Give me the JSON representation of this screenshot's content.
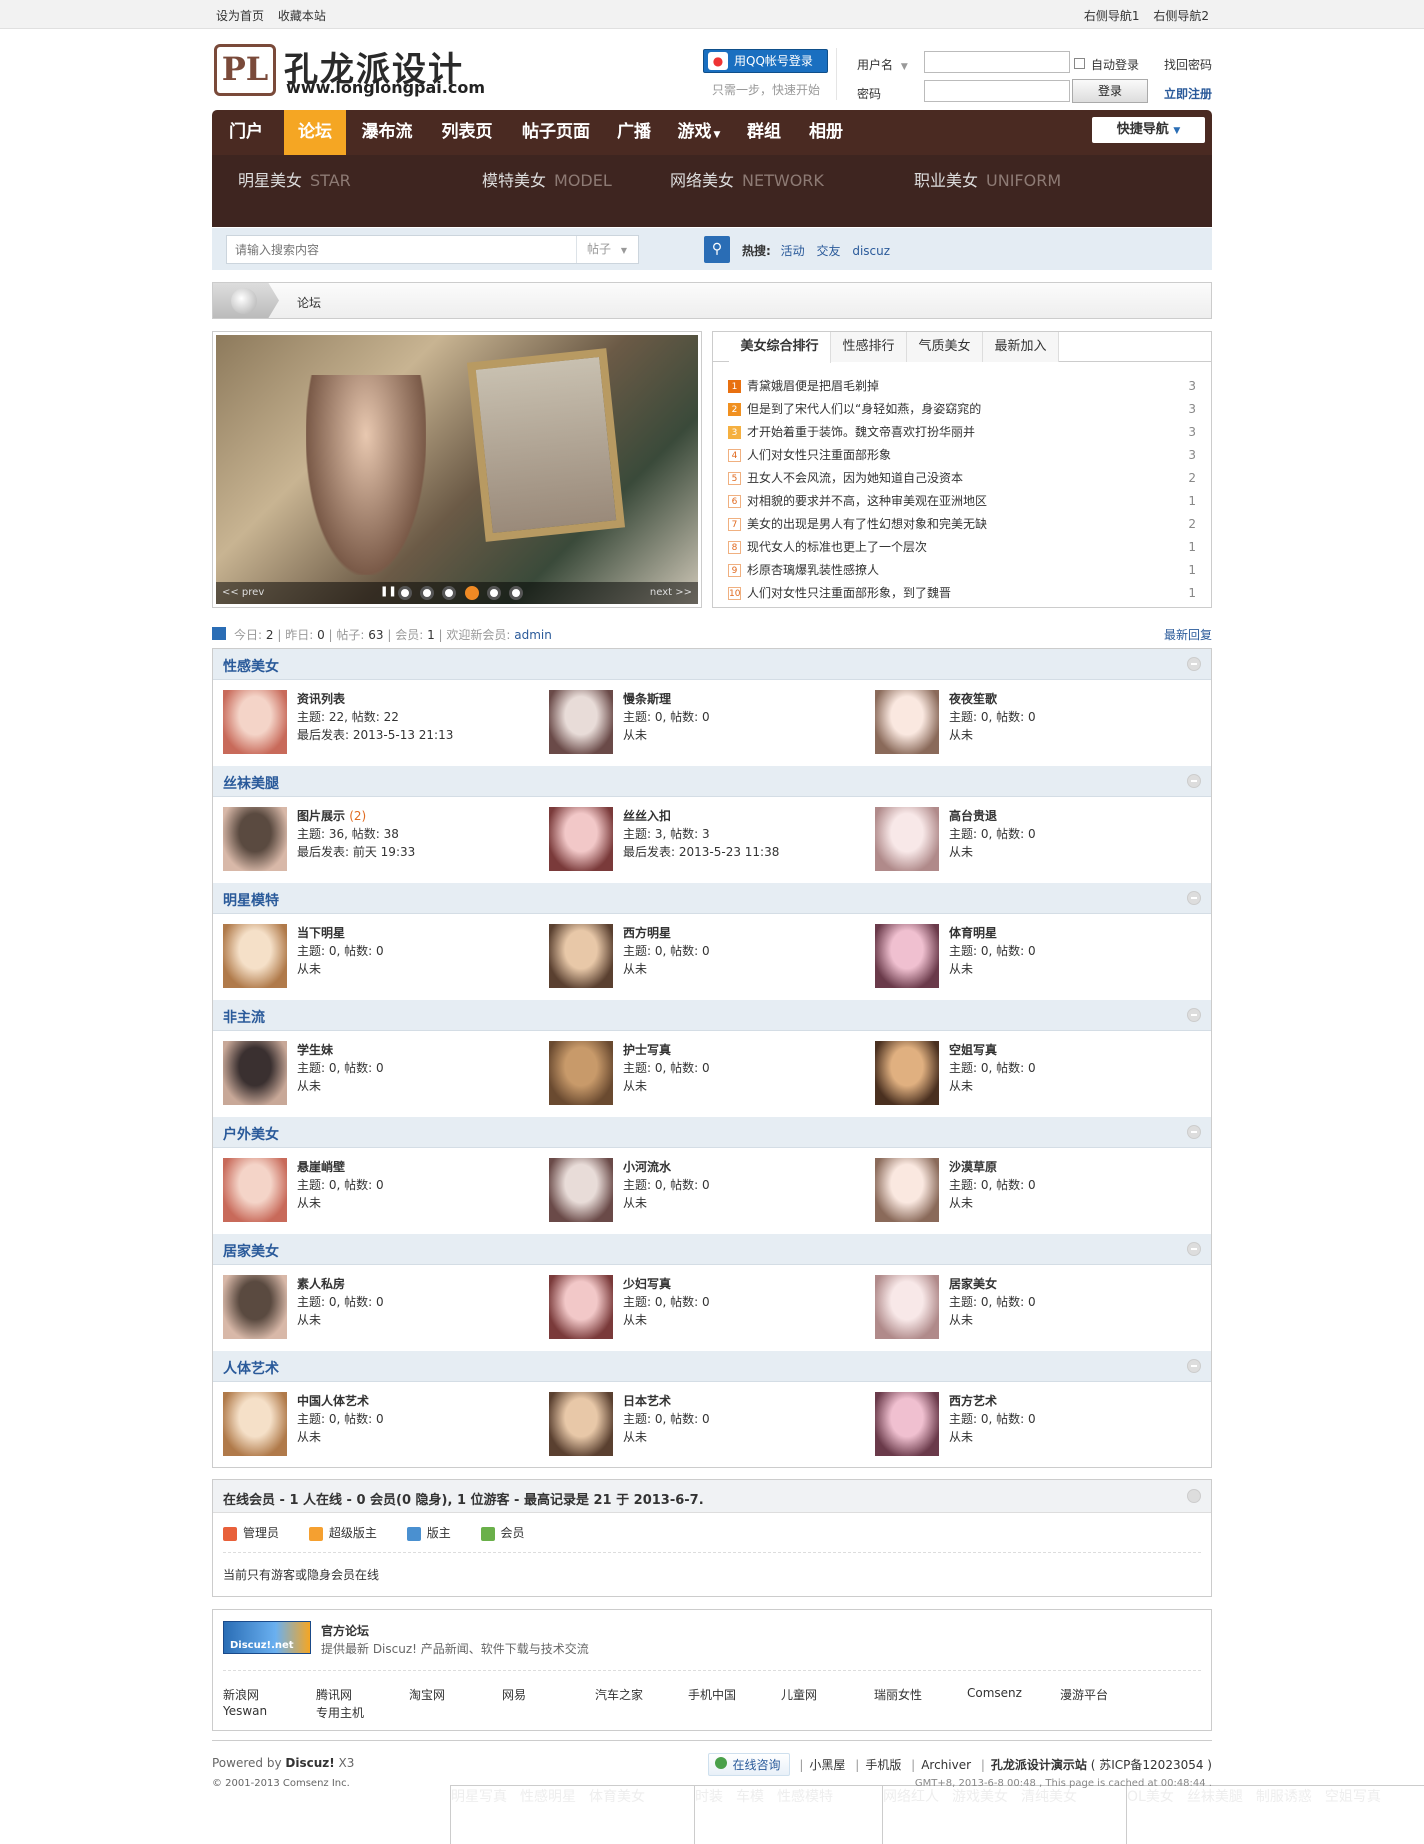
{
  "topbar": {
    "left": [
      "设为首页",
      "收藏本站"
    ],
    "right": [
      "右侧导航1",
      "右侧导航2"
    ]
  },
  "header": {
    "logo_mark": "PL",
    "logo_cn": "孔龙派设计",
    "logo_en": "www.longlongpai.com",
    "qq_login": "用QQ帐号登录",
    "qq_sub": "只需一步，快速开始",
    "username_label": "用户名",
    "password_label": "密码",
    "auto_login": "自动登录",
    "login_button": "登录",
    "forgot_password": "找回密码",
    "register": "立即注册"
  },
  "nav": {
    "items": [
      "门户",
      "论坛",
      "瀑布流",
      "列表页",
      "帖子页面",
      "广播",
      "游戏",
      "群组",
      "相册"
    ],
    "active": "论坛",
    "quick_nav": "快捷导航"
  },
  "subnav": [
    {
      "title": "明星美女",
      "en": "STAR",
      "links": [
        "明星写真",
        "性感明星",
        "体育美女"
      ]
    },
    {
      "title": "模特美女",
      "en": "MODEL",
      "links": [
        "时装",
        "车模",
        "性感模特"
      ]
    },
    {
      "title": "网络美女",
      "en": "NETWORK",
      "links": [
        "网络红人",
        "游戏美女",
        "清纯美女"
      ]
    },
    {
      "title": "职业美女",
      "en": "UNIFORM",
      "links": [
        "OL美女",
        "丝袜美腿",
        "制服诱惑",
        "空姐写真"
      ]
    }
  ],
  "search": {
    "placeholder": "请输入搜索内容",
    "type": "帖子",
    "hot_label": "热搜:",
    "hot": [
      "活动",
      "交友",
      "discuz"
    ]
  },
  "breadcrumb": "论坛",
  "slider": {
    "prev": "<< prev",
    "next": "next >>",
    "active_dot": 4,
    "dot_count": 6
  },
  "ranking": {
    "tabs": [
      "美女综合排行",
      "性感排行",
      "气质美女",
      "最新加入"
    ],
    "items": [
      {
        "n": "1",
        "title": "青黛娥眉便是把眉毛剃掉",
        "count": "3"
      },
      {
        "n": "2",
        "title": "但是到了宋代人们以“身轻如燕，身姿窈窕的",
        "count": "3"
      },
      {
        "n": "3",
        "title": "才开始着重于装饰。魏文帝喜欢打扮华丽并",
        "count": "3"
      },
      {
        "n": "4",
        "title": "人们对女性只注重面部形象",
        "count": "3"
      },
      {
        "n": "5",
        "title": "丑女人不会风流，因为她知道自己没资本",
        "count": "2"
      },
      {
        "n": "6",
        "title": "对相貌的要求并不高，这种审美观在亚洲地区",
        "count": "1"
      },
      {
        "n": "7",
        "title": "美女的出现是男人有了性幻想对象和完美无缺",
        "count": "2"
      },
      {
        "n": "8",
        "title": "现代女人的标准也更上了一个层次",
        "count": "1"
      },
      {
        "n": "9",
        "title": "杉原杏璃爆乳装性感撩人",
        "count": "1"
      },
      {
        "n": "10",
        "title": "人们对女性只注重面部形象，到了魏晋",
        "count": "1"
      }
    ]
  },
  "stats": {
    "today_label": "今日:",
    "today": "2",
    "yesterday_label": "昨日:",
    "yesterday": "0",
    "posts_label": "帖子:",
    "posts": "63",
    "members_label": "会员:",
    "members": "1",
    "welcome_label": "欢迎新会员:",
    "newest": "admin",
    "latest_reply": "最新回复"
  },
  "categories": [
    {
      "title": "性感美女",
      "forums": [
        {
          "name": "资讯列表",
          "new": "",
          "l2": "主题: 22, 帖数: 22",
          "l3": "最后发表: 2013-5-13 21:13"
        },
        {
          "name": "慢条斯理",
          "new": "",
          "l2": "主题: 0, 帖数: 0",
          "l3": "从未"
        },
        {
          "name": "夜夜笙歌",
          "new": "",
          "l2": "主题: 0, 帖数: 0",
          "l3": "从未"
        }
      ]
    },
    {
      "title": "丝袜美腿",
      "forums": [
        {
          "name": "图片展示",
          "new": "(2)",
          "l2": "主题: 36, 帖数: 38",
          "l3": "最后发表: 前天 19:33"
        },
        {
          "name": "丝丝入扣",
          "new": "",
          "l2": "主题: 3, 帖数: 3",
          "l3": "最后发表: 2013-5-23 11:38"
        },
        {
          "name": "高台贵退",
          "new": "",
          "l2": "主题: 0, 帖数: 0",
          "l3": "从未"
        }
      ]
    },
    {
      "title": "明星模特",
      "forums": [
        {
          "name": "当下明星",
          "new": "",
          "l2": "主题: 0, 帖数: 0",
          "l3": "从未"
        },
        {
          "name": "西方明星",
          "new": "",
          "l2": "主题: 0, 帖数: 0",
          "l3": "从未"
        },
        {
          "name": "体育明星",
          "new": "",
          "l2": "主题: 0, 帖数: 0",
          "l3": "从未"
        }
      ]
    },
    {
      "title": "非主流",
      "forums": [
        {
          "name": "学生妹",
          "new": "",
          "l2": "主题: 0, 帖数: 0",
          "l3": "从未"
        },
        {
          "name": "护士写真",
          "new": "",
          "l2": "主题: 0, 帖数: 0",
          "l3": "从未"
        },
        {
          "name": "空姐写真",
          "new": "",
          "l2": "主题: 0, 帖数: 0",
          "l3": "从未"
        }
      ]
    },
    {
      "title": "户外美女",
      "forums": [
        {
          "name": "悬崖峭壁",
          "new": "",
          "l2": "主题: 0, 帖数: 0",
          "l3": "从未"
        },
        {
          "name": "小河流水",
          "new": "",
          "l2": "主题: 0, 帖数: 0",
          "l3": "从未"
        },
        {
          "name": "沙漠草原",
          "new": "",
          "l2": "主题: 0, 帖数: 0",
          "l3": "从未"
        }
      ]
    },
    {
      "title": "居家美女",
      "forums": [
        {
          "name": "素人私房",
          "new": "",
          "l2": "主题: 0, 帖数: 0",
          "l3": "从未"
        },
        {
          "name": "少妇写真",
          "new": "",
          "l2": "主题: 0, 帖数: 0",
          "l3": "从未"
        },
        {
          "name": "居家美女",
          "new": "",
          "l2": "主题: 0, 帖数: 0",
          "l3": "从未"
        }
      ]
    },
    {
      "title": "人体艺术",
      "forums": [
        {
          "name": "中国人体艺术",
          "new": "",
          "l2": "主题: 0, 帖数: 0",
          "l3": "从未"
        },
        {
          "name": "日本艺术",
          "new": "",
          "l2": "主题: 0, 帖数: 0",
          "l3": "从未"
        },
        {
          "name": "西方艺术",
          "new": "",
          "l2": "主题: 0, 帖数: 0",
          "l3": "从未"
        }
      ]
    }
  ],
  "online": {
    "title": "在线会员 - 1 人在线 - 0 会员(0 隐身), 1 位游客 - 最高记录是 21 于 2013-6-7.",
    "legend": [
      {
        "label": "管理员",
        "color": "#e8603a"
      },
      {
        "label": "超级版主",
        "color": "#f5a030"
      },
      {
        "label": "版主",
        "color": "#4a90d0"
      },
      {
        "label": "会员",
        "color": "#6ab04a"
      }
    ],
    "note": "当前只有游客或隐身会员在线"
  },
  "links": {
    "banner": "Discuz!.net",
    "official_title": "官方论坛",
    "official_desc": "提供最新 Discuz! 产品新闻、软件下载与技术交流",
    "row1": [
      "新浪网",
      "腾讯网",
      "淘宝网",
      "网易",
      "汽车之家",
      "手机中国",
      "儿童网",
      "瑞丽女性",
      "Comsenz",
      "漫游平台"
    ],
    "row2": [
      "Yeswan",
      "专用主机"
    ]
  },
  "footer": {
    "powered_prefix": "Powered by ",
    "powered_brand": "Discuz!",
    "powered_version": " X3",
    "copyright": "© 2001-2013 Comsenz Inc.",
    "consult": "在线咨询",
    "links": [
      "小黑屋",
      "手机版",
      "Archiver"
    ],
    "site": "孔龙派设计演示站",
    "icp": "( 苏ICP备12023054 )",
    "gmt": "GMT+8, 2013-6-8 00:48 , This page is cached at 00:48:44 ."
  },
  "colors": {
    "nav_bg": "#4a2a22",
    "nav_active": "#f5a623",
    "accent_blue": "#2a5a9a"
  }
}
